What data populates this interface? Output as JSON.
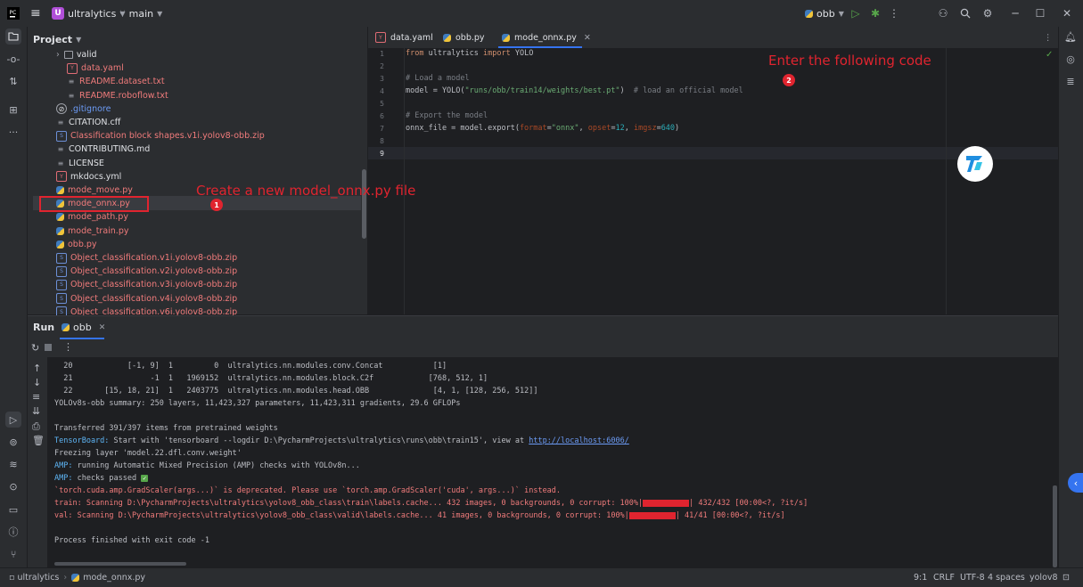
{
  "titlebar": {
    "project_badge": "U",
    "project_name": "ultralytics",
    "branch": "main",
    "run_config": "obb"
  },
  "project_panel": {
    "title": "Project",
    "items": [
      {
        "label": "valid",
        "type": "folder",
        "color": "normal"
      },
      {
        "label": "data.yaml",
        "type": "yaml",
        "color": "red"
      },
      {
        "label": "README.dataset.txt",
        "type": "txt",
        "color": "red"
      },
      {
        "label": "README.roboflow.txt",
        "type": "txt",
        "color": "red"
      },
      {
        "label": ".gitignore",
        "type": "git",
        "color": "blue"
      },
      {
        "label": "CITATION.cff",
        "type": "txt",
        "color": "normal"
      },
      {
        "label": "Classification block shapes.v1i.yolov8-obb.zip",
        "type": "zip",
        "color": "red"
      },
      {
        "label": "CONTRIBUTING.md",
        "type": "txt",
        "color": "normal"
      },
      {
        "label": "LICENSE",
        "type": "lic",
        "color": "normal"
      },
      {
        "label": "mkdocs.yml",
        "type": "yaml",
        "color": "normal"
      },
      {
        "label": "mode_move.py",
        "type": "py",
        "color": "red"
      },
      {
        "label": "mode_onnx.py",
        "type": "py",
        "color": "red"
      },
      {
        "label": "mode_path.py",
        "type": "py",
        "color": "red"
      },
      {
        "label": "mode_train.py",
        "type": "py",
        "color": "red"
      },
      {
        "label": "obb.py",
        "type": "py",
        "color": "red"
      },
      {
        "label": "Object_classification.v1i.yolov8-obb.zip",
        "type": "zip",
        "color": "red"
      },
      {
        "label": "Object_classification.v2i.yolov8-obb.zip",
        "type": "zip",
        "color": "red"
      },
      {
        "label": "Object_classification.v3i.yolov8-obb.zip",
        "type": "zip",
        "color": "red"
      },
      {
        "label": "Object_classification.v4i.yolov8-obb.zip",
        "type": "zip",
        "color": "red"
      },
      {
        "label": "Object_classification.v6i.yolov8-obb.zip",
        "type": "zip",
        "color": "red"
      }
    ]
  },
  "editor": {
    "tabs": [
      {
        "label": "data.yaml",
        "type": "yaml"
      },
      {
        "label": "obb.py",
        "type": "py"
      },
      {
        "label": "mode_onnx.py",
        "type": "py",
        "active": true
      }
    ],
    "line_numbers": [
      "1",
      "2",
      "3",
      "4",
      "5",
      "6",
      "7",
      "8",
      "9"
    ],
    "code": {
      "l1_kw1": "from",
      "l1_mod": " ultralytics ",
      "l1_kw2": "import",
      "l1_name": " YOLO",
      "l3": "# Load a model",
      "l4_a": "model = YOLO(",
      "l4_str": "\"runs/obb/train14/weights/best.pt\"",
      "l4_b": ")  ",
      "l4_cmt": "# load an official model",
      "l6": "# Export the model",
      "l7_a": "onnx_file = model.export(",
      "l7_p1": "format",
      "l7_eq1": "=",
      "l7_s1": "\"onnx\"",
      "l7_c1": ", ",
      "l7_p2": "opset",
      "l7_eq2": "=",
      "l7_n1": "12",
      "l7_c2": ", ",
      "l7_p3": "imgsz",
      "l7_eq3": "=",
      "l7_n2": "640",
      "l7_end": ")"
    }
  },
  "annotations": {
    "step1_text": "Create a new model_onnx.py file",
    "step1_num": "1",
    "step2_text": "Enter the following code",
    "step2_num": "2"
  },
  "run_panel": {
    "title": "Run",
    "tab": "obb",
    "lines": {
      "l1": "  20            [-1, 9]  1         0  ultralytics.nn.modules.conv.Concat           [1]",
      "l2": "  21                 -1  1   1969152  ultralytics.nn.modules.block.C2f            [768, 512, 1]",
      "l3": "  22       [15, 18, 21]  1   2403775  ultralytics.nn.modules.head.OBB              [4, 1, [128, 256, 512]]",
      "l4": "YOLOv8s-obb summary: 250 layers, 11,423,327 parameters, 11,423,311 gradients, 29.6 GFLOPs",
      "l5": "Transferred 391/397 items from pretrained weights",
      "l6_label": "TensorBoard: ",
      "l6_text": "Start with 'tensorboard --logdir D:\\PycharmProjects\\ultralytics\\runs\\obb\\train15', view at ",
      "l6_link": "http://localhost:6006/",
      "l7": "Freezing layer 'model.22.dfl.conv.weight'",
      "l8_label": "AMP: ",
      "l8_text": "running Automatic Mixed Precision (AMP) checks with YOLOv8n...",
      "l9_label": "AMP: ",
      "l9_text": "checks passed ",
      "l10": "`torch.cuda.amp.GradScaler(args...)` is deprecated. Please use `torch.amp.GradScaler('cuda', args...)` instead.",
      "l11_a": "train: Scanning D:\\PycharmProjects\\ultralytics\\yolov8_obb_class\\train\\labels.cache... 432 images, 0 backgrounds, 0 corrupt: 100%|",
      "l11_b": "| 432/432 [00:00<?, ?it/s]",
      "l12_a": "val: Scanning D:\\PycharmProjects\\ultralytics\\yolov8_obb_class\\valid\\labels.cache... 41 images, 0 backgrounds, 0 corrupt: 100%|",
      "l12_b": "| 41/41 [00:00<?, ?it/s]",
      "l13": "Process finished with exit code -1",
      "train_progress": 1.0,
      "val_progress": 1.0
    }
  },
  "statusbar": {
    "project": "ultralytics",
    "file": "mode_onnx.py",
    "position": "9:1",
    "line_sep": "CRLF",
    "encoding": "UTF-8",
    "indent": "4 spaces",
    "interpreter": "yolov8"
  }
}
